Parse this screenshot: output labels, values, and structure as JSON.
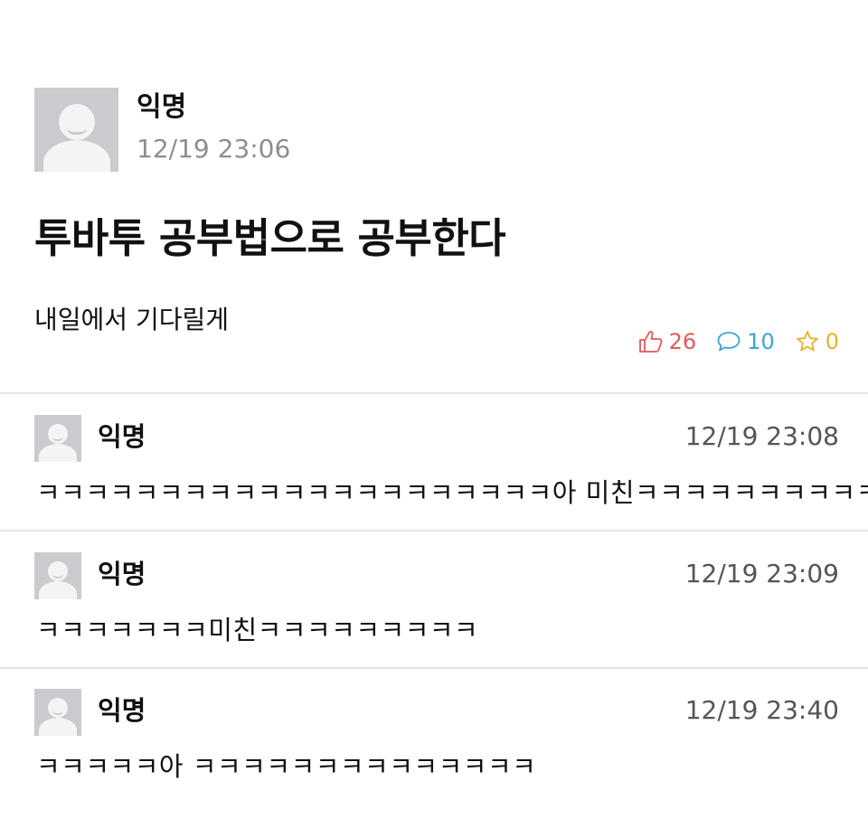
{
  "post": {
    "author": "익명",
    "time": "12/19 23:06",
    "title": "투바투 공부법으로 공부한다",
    "body": "내일에서 기다릴게",
    "likes": "26",
    "comments": "10",
    "scraps": "0"
  },
  "colors": {
    "like": "#e05a5a",
    "comment": "#3aa5d8",
    "scrap": "#e9b22a"
  },
  "comments": [
    {
      "author": "익명",
      "time": "12/19 23:08",
      "text": "ㅋㅋㅋㅋㅋㅋㅋㅋㅋㅋㅋㅋㅋㅋㅋㅋㅋㅋㅋㅋㅋ아 미친ㅋㅋㅋㅋㅋㅋㅋㅋㅋㅋ"
    },
    {
      "author": "익명",
      "time": "12/19 23:09",
      "text": "ㅋㅋㅋㅋㅋㅋㅋ미친ㅋㅋㅋㅋㅋㅋㅋㅋㅋ"
    },
    {
      "author": "익명",
      "time": "12/19 23:40",
      "text": "ㅋㅋㅋㅋㅋ아 ㅋㅋㅋㅋㅋㅋㅋㅋㅋㅋㅋㅋㅋㅋ"
    }
  ]
}
